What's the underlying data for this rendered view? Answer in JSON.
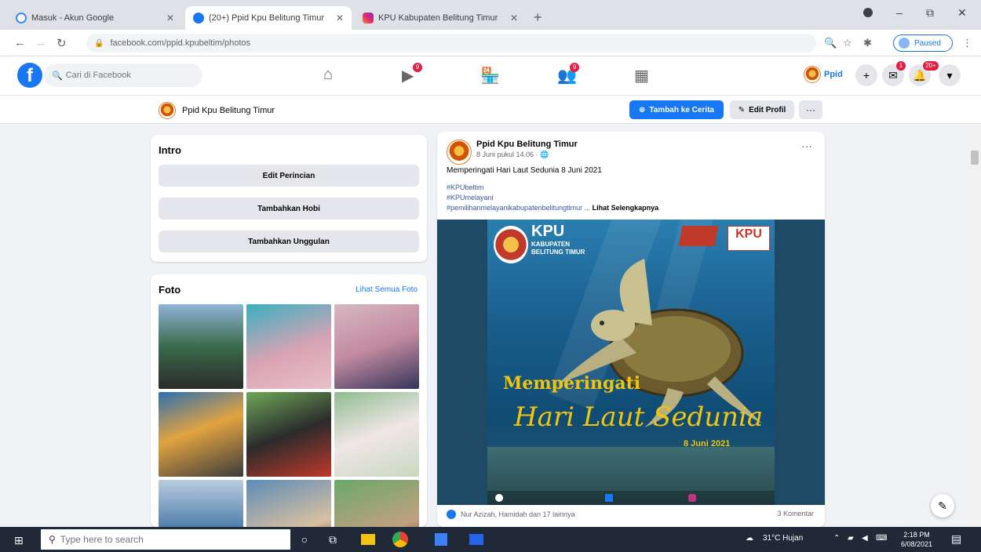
{
  "browser": {
    "tabs": [
      {
        "label": "Masuk - Akun Google",
        "favicon_color": "#4285f4",
        "active": false
      },
      {
        "label": "(20+) Ppid Kpu Belitung Timur",
        "favicon_color": "#1877f2",
        "active": true
      },
      {
        "label": "KPU Kabupaten Belitung Timur",
        "favicon_color": "#c13584",
        "active": false
      }
    ],
    "new_tab": "+",
    "url": "facebook.com/ppid.kpubeltim/photos",
    "profile_label": "Paused"
  },
  "facebook": {
    "logo": "f",
    "search_placeholder": "Cari di Facebook",
    "nav_badges": {
      "watch": "9",
      "groups": "9"
    },
    "me_name": "Ppid",
    "messenger_badge": "1",
    "notif_badge": "20+",
    "profile_name": "Ppid Kpu Belitung Timur",
    "story_button": "Tambah ke Cerita",
    "edit_button": "Edit Profil",
    "more_button": "···"
  },
  "intro": {
    "title": "Intro",
    "buttons": [
      "Edit Perincian",
      "Tambahkan Hobi",
      "Tambahkan Unggulan"
    ]
  },
  "photos": {
    "title": "Foto",
    "see_all": "Lihat Semua Foto"
  },
  "post": {
    "author": "Ppid Kpu Belitung Timur",
    "meta": "8 Juni pukul 14.06 · 🌐",
    "text": "Memperingati Hari Laut Sedunia 8 Juni 2021",
    "hashtags": [
      "#KPUbeltim",
      "#KPUmelayani"
    ],
    "hashtag_line": "#pemilihanmelayanikabupatenbelitungtimur",
    "see_more": "Lihat Selengkapnya",
    "image": {
      "kpu": "KPU",
      "kabupaten": "KABUPATEN",
      "region": "BELITUNG TIMUR",
      "kpu_badge": "KPU",
      "headline": "Memperingati",
      "script_title": "Hari Laut Sedunia",
      "date": "8 Juni 2021"
    },
    "reactions": "Nur Azizah, Hamidah dan 17 lainnya",
    "comments": "3 Komentar"
  },
  "taskbar": {
    "search_placeholder": "Type here to search",
    "weather": "31°C Hujan",
    "time": "2:18 PM",
    "date": "6/08/2021"
  },
  "colors": {
    "fb_blue": "#1877f2",
    "badge_red": "#e41e3f",
    "page_bg": "#f0f2f5"
  }
}
